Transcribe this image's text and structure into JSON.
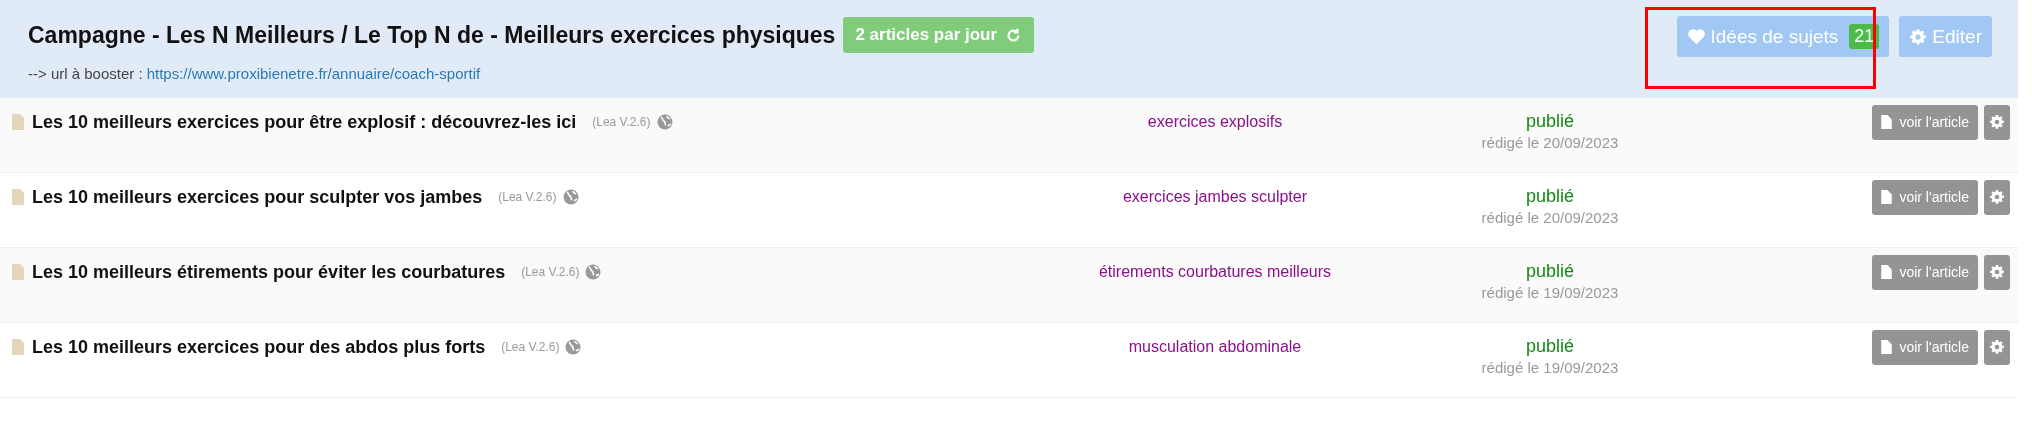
{
  "header": {
    "title": "Campagne - Les N Meilleurs / Le Top N de - Meilleurs exercices physiques",
    "frequency_button": "2 articles par jour",
    "url_label": "--> url à booster :",
    "url": "https://www.proxibienetre.fr/annuaire/coach-sportif",
    "ideas_button": {
      "label": "Idées de sujets",
      "count": "21"
    },
    "edit_button": "Editer"
  },
  "articles": [
    {
      "title": "Les 10 meilleurs exercices pour être explosif : découvrez-les ici",
      "version": "(Lea V.2.6)",
      "keyword": "exercices explosifs",
      "status": "publié",
      "date": "rédigé le 20/09/2023",
      "view_button": "voir l'article"
    },
    {
      "title": "Les 10 meilleurs exercices pour sculpter vos jambes",
      "version": "(Lea V.2.6)",
      "keyword": "exercices jambes sculpter",
      "status": "publié",
      "date": "rédigé le 20/09/2023",
      "view_button": "voir l'article"
    },
    {
      "title": "Les 10 meilleurs étirements pour éviter les courbatures",
      "version": "(Lea V.2.6)",
      "keyword": "étirements courbatures meilleurs",
      "status": "publié",
      "date": "rédigé le 19/09/2023",
      "view_button": "voir l'article"
    },
    {
      "title": "Les 10 meilleurs exercices pour des abdos plus forts",
      "version": "(Lea V.2.6)",
      "keyword": "musculation abdominale",
      "status": "publié",
      "date": "rédigé le 19/09/2023",
      "view_button": "voir l'article"
    }
  ]
}
